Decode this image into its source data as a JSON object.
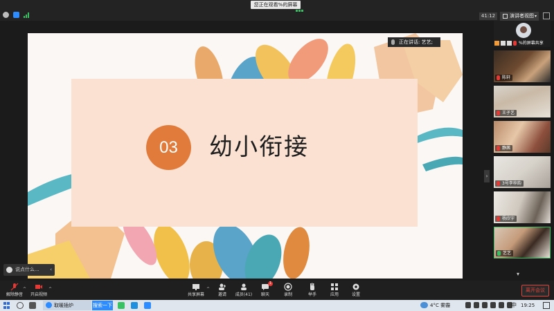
{
  "topbar": {
    "viewing_banner": "您正在观看%的屏幕",
    "meeting_timer": "41:12",
    "view_mode_label": "演讲者视图",
    "speaking_label": "正在讲话: 艺艺;"
  },
  "slide": {
    "section_number": "03",
    "title": "幼小衔接",
    "colors": {
      "accent_orange": "#e07b3b",
      "panel_peach": "#fbe1d2",
      "background": "#fbf7f4"
    }
  },
  "chat_prompt": {
    "placeholder": "说点什么..."
  },
  "gallery": {
    "me_label": "%的屏幕共享",
    "participants": [
      {
        "name": "陈轩"
      },
      {
        "name": "王子艺"
      },
      {
        "name": "静茜"
      },
      {
        "name": "3号李梓韵"
      },
      {
        "name": "杨欣宇"
      },
      {
        "name": "艺艺"
      }
    ]
  },
  "toolbar": {
    "mute_label": "解除静音",
    "video_label": "开启视频",
    "share_label": "共享屏幕",
    "invite_label": "邀请",
    "participants_label": "成员(41)",
    "chat_label": "聊天",
    "chat_badge": "1",
    "record_label": "录制",
    "raise_hand_label": "举手",
    "apps_label": "应用",
    "settings_label": "设置",
    "leave_label": "离开会议"
  },
  "taskbar": {
    "ie_task_label": "取暖插炉",
    "search_button_label": "搜索一下",
    "weather": "4°C 雾霾",
    "ime": "中",
    "clock": "19:25"
  }
}
